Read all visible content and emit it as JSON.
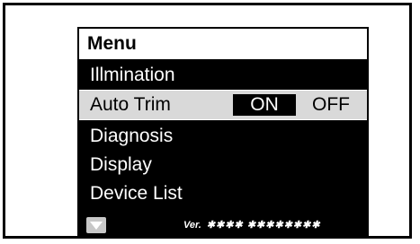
{
  "menu": {
    "title": "Menu",
    "items": [
      {
        "label": "Illmination"
      },
      {
        "label": "Auto Trim",
        "on_label": "ON",
        "off_label": "OFF",
        "selected_value": "ON"
      },
      {
        "label": "Diagnosis"
      },
      {
        "label": "Display"
      },
      {
        "label": "Device List"
      }
    ]
  },
  "footer": {
    "scroll_icon": "triangle-down-icon",
    "version_label": "Ver.",
    "version_value": "✱✱✱✱ ✱✱✱✱✱✱✱✱"
  },
  "colors": {
    "screen_bg": "#000000",
    "highlight_bg": "#d9d9d9",
    "header_bg": "#ffffff"
  }
}
